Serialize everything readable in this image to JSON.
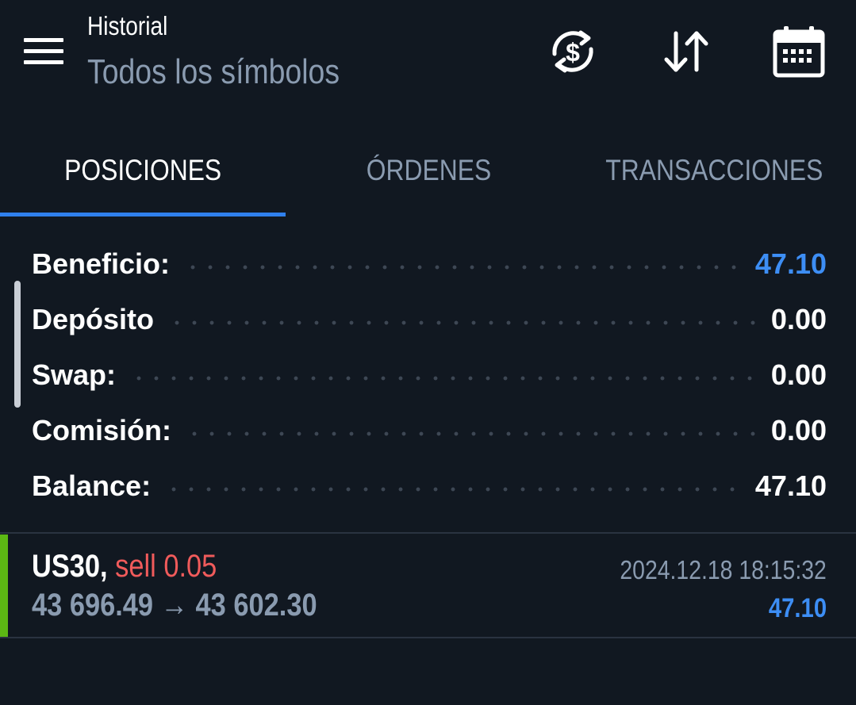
{
  "header": {
    "title": "Historial",
    "subtitle": "Todos los símbolos",
    "icons": [
      "menu-icon",
      "currency-exchange-icon",
      "sort-icon",
      "calendar-icon"
    ]
  },
  "tabs": [
    {
      "label": "POSICIONES",
      "active": true
    },
    {
      "label": "ÓRDENES",
      "active": false
    },
    {
      "label": "TRANSACCIONES",
      "active": false
    }
  ],
  "summary": [
    {
      "label": "Beneficio:",
      "value": "47.10"
    },
    {
      "label": "Depósito",
      "value": "0.00"
    },
    {
      "label": "Swap:",
      "value": "0.00"
    },
    {
      "label": "Comisión:",
      "value": "0.00"
    },
    {
      "label": "Balance:",
      "value": "47.10"
    }
  ],
  "position": {
    "symbol": "US30,",
    "type": "sell 0.05",
    "prices": "43 696.49 → 43 602.30",
    "datetime": "2024.12.18 18:15:32",
    "profit": "47.10"
  },
  "colors": {
    "background": "#111821",
    "accent": "#2f80ed",
    "profit_blue": "#3d8ef5",
    "sell_red": "#f05b5b",
    "buy_green": "#5cb814",
    "muted": "#8a9bb0"
  }
}
